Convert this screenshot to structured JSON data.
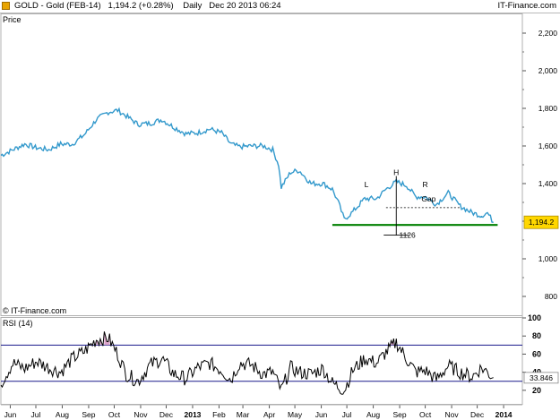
{
  "header": {
    "title": "GOLD - Gold (FEB-14)",
    "quote": "1,194.2 (+0.28%)",
    "period": "Daily",
    "datetime": "Dec 20 2013 06:24",
    "brand": "IT-Finance.com"
  },
  "colors": {
    "price_line": "#3399cc",
    "support_line": "#008000",
    "rsi_line": "#000000",
    "rsi_band": "#1a1a8c",
    "rsi_overbought_fill": "#dba3c8",
    "last_price_badge": "#ffd700"
  },
  "chart_data": [
    {
      "type": "line",
      "title": "Price",
      "watermark": "© IT-Finance.com",
      "ylim": [
        700,
        2300
      ],
      "yticks": [
        800,
        1000,
        1200,
        1400,
        1600,
        1800,
        2000,
        2200
      ],
      "ytick_labels": [
        "800",
        "1,000",
        "1,200",
        "1,400",
        "1,600",
        "1,800",
        "2,000",
        "2,200"
      ],
      "last_price": 1194.2,
      "last_price_label": "1,194.2",
      "x_labels": [
        "Jun",
        "Jul",
        "Aug",
        "Sep",
        "Oct",
        "Nov",
        "Dec",
        "2013",
        "Feb",
        "Mar",
        "Apr",
        "May",
        "Jun",
        "Jul",
        "Aug",
        "Sep",
        "Oct",
        "Nov",
        "Dec",
        "2014"
      ],
      "x_start": "2012-05-21",
      "x_end": "2014-01-23",
      "x_ticks": [
        "2012-06-01",
        "2012-07-01",
        "2012-08-01",
        "2012-09-01",
        "2012-10-01",
        "2012-11-01",
        "2012-12-01",
        "2013-01-01",
        "2013-02-01",
        "2013-03-01",
        "2013-04-01",
        "2013-05-01",
        "2013-06-01",
        "2013-07-01",
        "2013-08-01",
        "2013-09-01",
        "2013-10-01",
        "2013-11-01",
        "2013-12-01",
        "2014-01-01"
      ],
      "series": [
        {
          "x": [
            "2012-05-21",
            "2012-06-04",
            "2012-06-18",
            "2012-07-02",
            "2012-07-16",
            "2012-07-30",
            "2012-08-13",
            "2012-08-27",
            "2012-09-10",
            "2012-09-24",
            "2012-10-05",
            "2012-10-15",
            "2012-10-29",
            "2012-11-12",
            "2012-11-26",
            "2012-12-10",
            "2012-12-24",
            "2013-01-07",
            "2013-01-21",
            "2013-02-04",
            "2013-02-15",
            "2013-02-25",
            "2013-03-11",
            "2013-03-25",
            "2013-04-05",
            "2013-04-12",
            "2013-04-15",
            "2013-04-26",
            "2013-05-06",
            "2013-05-20",
            "2013-06-03",
            "2013-06-14",
            "2013-06-21",
            "2013-06-28",
            "2013-07-08",
            "2013-07-22",
            "2013-08-05",
            "2013-08-16",
            "2013-08-28",
            "2013-09-09",
            "2013-09-20",
            "2013-10-01",
            "2013-10-14",
            "2013-10-28",
            "2013-11-11",
            "2013-11-25",
            "2013-12-06",
            "2013-12-13",
            "2013-12-20"
          ],
          "values": [
            1550,
            1580,
            1610,
            1590,
            1580,
            1610,
            1610,
            1660,
            1740,
            1780,
            1790,
            1760,
            1715,
            1720,
            1740,
            1700,
            1665,
            1670,
            1690,
            1670,
            1610,
            1595,
            1600,
            1600,
            1580,
            1500,
            1380,
            1460,
            1470,
            1400,
            1400,
            1370,
            1300,
            1210,
            1250,
            1320,
            1320,
            1370,
            1410,
            1390,
            1330,
            1330,
            1290,
            1350,
            1280,
            1245,
            1230,
            1245,
            1194
          ]
        }
      ],
      "annotations": [
        {
          "text": "L",
          "x": "2013-07-24",
          "y": 1380
        },
        {
          "text": "H",
          "x": "2013-08-28",
          "y": 1445
        },
        {
          "text": "R",
          "x": "2013-10-01",
          "y": 1380
        },
        {
          "text": "Gap",
          "x": "2013-10-05",
          "y": 1305
        },
        {
          "text": "1126",
          "x": "2013-09-10",
          "y": 1112
        }
      ],
      "neckline": {
        "y": 1272,
        "x_from": "2013-08-16",
        "x_to": "2013-11-11"
      },
      "support": {
        "y": 1180,
        "x_from": "2013-06-14",
        "x_to": "2013-12-25"
      },
      "pattern_height": {
        "x": "2013-08-28",
        "y_from": 1440,
        "y_to": 1272
      },
      "target_projection": {
        "x": "2013-08-28",
        "y_from": 1272,
        "y_to": 1126
      }
    },
    {
      "type": "line",
      "title": "RSI (14)",
      "ylim": [
        5,
        100
      ],
      "yticks": [
        20,
        40,
        60,
        80,
        100
      ],
      "ytick_labels": [
        "20",
        "40",
        "60",
        "80",
        "100"
      ],
      "bands": [
        30,
        70
      ],
      "last_value": 33.846,
      "last_value_label": "33.846",
      "series": [
        {
          "x": [
            "2012-05-21",
            "2012-06-04",
            "2012-06-18",
            "2012-07-02",
            "2012-07-16",
            "2012-07-30",
            "2012-08-13",
            "2012-08-27",
            "2012-09-10",
            "2012-09-24",
            "2012-10-05",
            "2012-10-15",
            "2012-10-29",
            "2012-11-12",
            "2012-11-26",
            "2012-12-10",
            "2012-12-24",
            "2013-01-07",
            "2013-01-21",
            "2013-02-04",
            "2013-02-15",
            "2013-02-25",
            "2013-03-11",
            "2013-03-25",
            "2013-04-05",
            "2013-04-15",
            "2013-04-26",
            "2013-05-06",
            "2013-05-20",
            "2013-06-03",
            "2013-06-14",
            "2013-06-28",
            "2013-07-08",
            "2013-07-22",
            "2013-08-05",
            "2013-08-16",
            "2013-08-28",
            "2013-09-09",
            "2013-09-20",
            "2013-10-01",
            "2013-10-14",
            "2013-10-28",
            "2013-11-11",
            "2013-11-25",
            "2013-12-06",
            "2013-12-13",
            "2013-12-20"
          ],
          "values": [
            28,
            50,
            44,
            52,
            45,
            40,
            55,
            63,
            76,
            78,
            60,
            38,
            30,
            48,
            55,
            38,
            33,
            45,
            50,
            42,
            32,
            50,
            48,
            38,
            40,
            20,
            45,
            40,
            38,
            44,
            28,
            20,
            42,
            55,
            50,
            62,
            73,
            55,
            40,
            42,
            32,
            47,
            40,
            35,
            45,
            40,
            34
          ]
        }
      ]
    }
  ]
}
